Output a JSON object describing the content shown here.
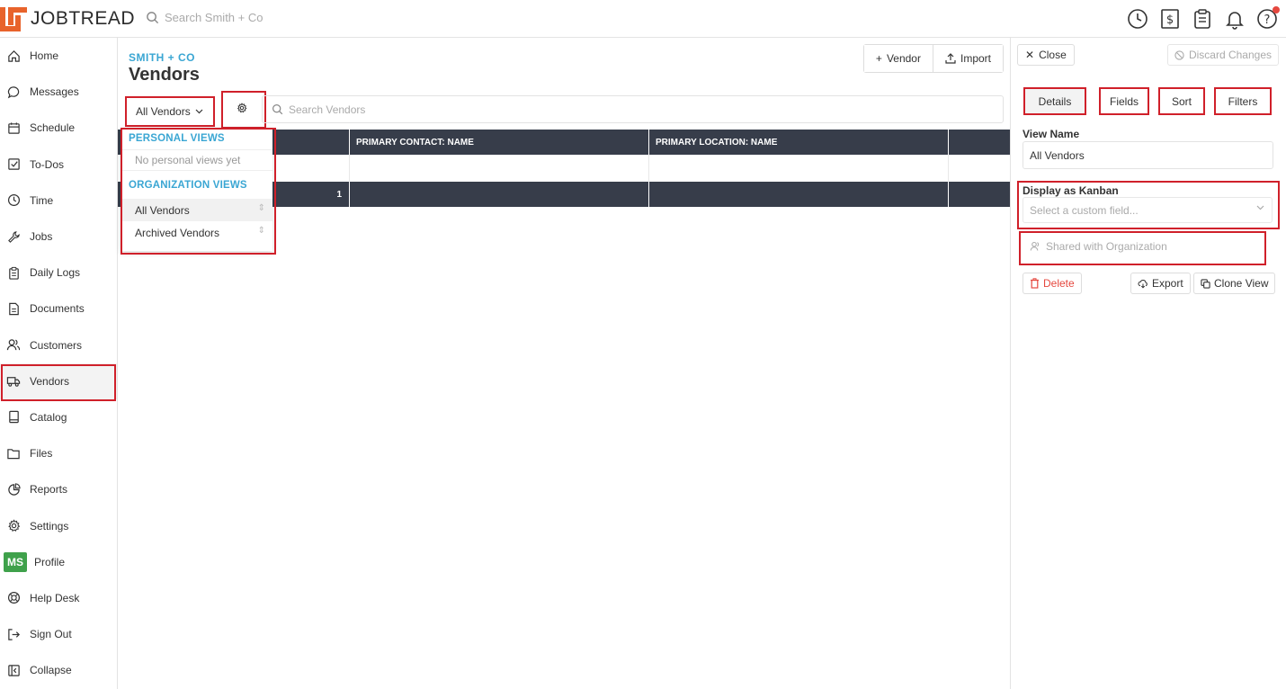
{
  "brand": {
    "name": "JOBTREAD",
    "accent": "#e8632b"
  },
  "topbar": {
    "search_placeholder": "Search Smith + Co",
    "icons": [
      "clock-icon",
      "invoice-dollar-icon",
      "clipboard-icon",
      "bell-icon",
      "help-icon"
    ]
  },
  "sidebar": {
    "items": [
      {
        "label": "Home",
        "icon": "home-icon"
      },
      {
        "label": "Messages",
        "icon": "chat-icon"
      },
      {
        "label": "Schedule",
        "icon": "calendar-icon"
      },
      {
        "label": "To-Dos",
        "icon": "checkbox-icon"
      },
      {
        "label": "Time",
        "icon": "clock-icon"
      },
      {
        "label": "Jobs",
        "icon": "wrench-icon"
      },
      {
        "label": "Daily Logs",
        "icon": "clipboard-icon"
      },
      {
        "label": "Documents",
        "icon": "document-icon"
      },
      {
        "label": "Customers",
        "icon": "users-icon"
      },
      {
        "label": "Vendors",
        "icon": "truck-icon"
      },
      {
        "label": "Catalog",
        "icon": "book-icon"
      },
      {
        "label": "Files",
        "icon": "folder-icon"
      },
      {
        "label": "Reports",
        "icon": "pie-chart-icon"
      },
      {
        "label": "Settings",
        "icon": "gear-icon"
      },
      {
        "label": "Profile",
        "avatar": "MS"
      },
      {
        "label": "Help Desk",
        "icon": "lifebuoy-icon"
      },
      {
        "label": "Sign Out",
        "icon": "sign-out-icon"
      },
      {
        "label": "Collapse",
        "icon": "collapse-icon"
      }
    ]
  },
  "main": {
    "breadcrumb": "SMITH + CO",
    "title": "Vendors",
    "add_vendor_label": "Vendor",
    "import_label": "Import",
    "view_selector": "All Vendors",
    "search_placeholder": "Search Vendors",
    "table": {
      "columns": [
        "",
        "PRIMARY CONTACT: NAME",
        "PRIMARY LOCATION: NAME",
        ""
      ],
      "footer_count": "1"
    },
    "views_dropdown": {
      "personal_header": "PERSONAL VIEWS",
      "personal_empty": "No personal views yet",
      "org_header": "ORGANIZATION VIEWS",
      "org_views": [
        "All Vendors",
        "Archived Vendors"
      ]
    }
  },
  "panel": {
    "close_label": "Close",
    "discard_label": "Discard Changes",
    "tabs": [
      "Details",
      "Fields",
      "Sort",
      "Filters"
    ],
    "view_name_label": "View Name",
    "view_name_value": "All Vendors",
    "kanban_label": "Display as Kanban",
    "kanban_placeholder": "Select a custom field...",
    "shared_label": "Shared with Organization",
    "delete_label": "Delete",
    "export_label": "Export",
    "clone_label": "Clone View"
  }
}
